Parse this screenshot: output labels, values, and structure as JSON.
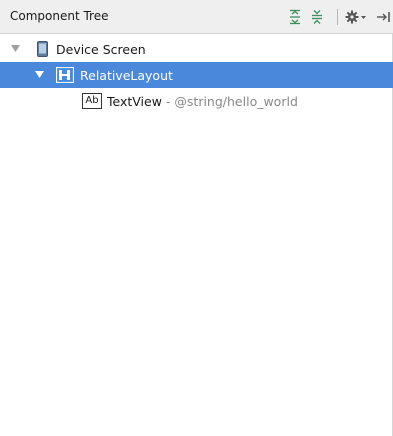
{
  "header": {
    "title": "Component Tree"
  },
  "tree": {
    "items": [
      {
        "label": "Device Screen",
        "icon": "phone-icon",
        "expanded": true,
        "selected": false
      },
      {
        "label": "RelativeLayout",
        "icon": "relative-layout-icon",
        "expanded": true,
        "selected": true
      },
      {
        "label": "TextView",
        "detail": " - @string/hello_world",
        "icon": "textview-icon",
        "icon_text": "Ab",
        "selected": false
      }
    ]
  },
  "colors": {
    "selection": "#4a88dc",
    "toolbar_icon": "#3c8f5c",
    "detail_text": "#888888"
  }
}
